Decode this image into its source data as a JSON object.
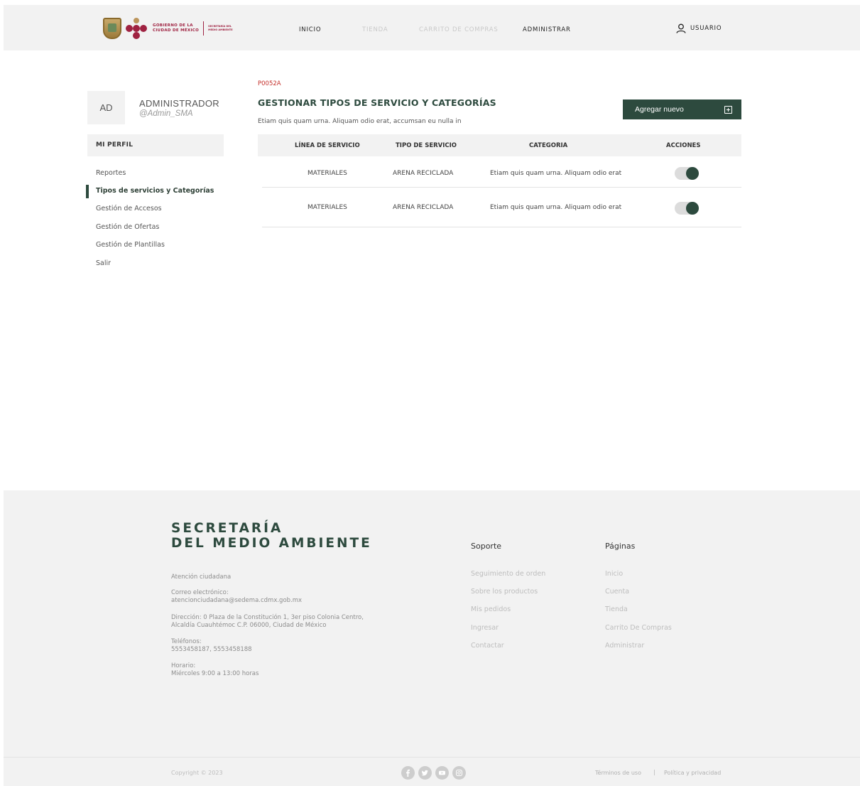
{
  "header": {
    "logo_gov_line1": "GOBIERNO DE LA",
    "logo_gov_line2": "CIUDAD DE MÉXICO",
    "logo_sec_line1": "SECRETARÍA DEL",
    "logo_sec_line2": "MEDIO AMBIENTE",
    "nav": [
      "INICIO",
      "TIENDA",
      "CARRITO DE COMPRAS",
      "ADMINISTRAR"
    ],
    "user_label": "USUARIO"
  },
  "sidebar": {
    "initials": "AD",
    "name": "ADMINISTRADOR",
    "handle": "@Admin_SMA",
    "section_title": "MI PERFIL",
    "items": [
      "Reportes",
      "Tipos de servicios y Categorías",
      "Gestión de Accesos",
      "Gestión de Ofertas",
      "Gestión de Plantillas",
      "Salir"
    ],
    "active_index": 1
  },
  "main": {
    "code": "P0052A",
    "title": "GESTIONAR TIPOS DE SERVICIO Y CATEGORÍAS",
    "subtitle": "Etiam quis quam urna. Aliquam odio erat, accumsan eu nulla in",
    "add_button_label": "Agregar nuevo",
    "table": {
      "columns": [
        "LÍNEA DE SERVICIO",
        "TIPO DE SERVICIO",
        "CATEGORIA",
        "ACCIONES"
      ],
      "rows": [
        {
          "linea": "MATERIALES",
          "tipo": "ARENA RECICLADA",
          "categoria": "Etiam quis quam urna. Aliquam odio erat",
          "active": true
        },
        {
          "linea": "MATERIALES",
          "tipo": "ARENA RECICLADA",
          "categoria": "Etiam quis quam urna. Aliquam odio erat",
          "active": true
        }
      ]
    }
  },
  "footer": {
    "title_line1": "SECRETARÍA",
    "title_line2": "DEL MEDIO AMBIENTE",
    "attention": "Atención ciudadana",
    "email_label": "Correo electrónico:",
    "email": "atencionciudadana@sedema.cdmx.gob.mx",
    "address_line1": "Dirección: 0 Plaza de la Constitución 1, 3er piso Colonia Centro,",
    "address_line2": "Alcaldía Cuauhtémoc C.P. 06000, Ciudad de México",
    "phones_label": "Teléfonos:",
    "phones": "5553458187, 5553458188",
    "hours_label": "Horario:",
    "hours": "Miércoles 9:00 a 13:00 horas",
    "support_title": "Soporte",
    "support_links": [
      "Seguimiento de orden",
      "Sobre los productos",
      "Mis pedidos",
      "Ingresar",
      "Contactar"
    ],
    "pages_title": "Páginas",
    "pages_links": [
      "Inicio",
      "Cuenta",
      "Tienda",
      "Carrito De Compras",
      "Administrar"
    ],
    "copyright": "Copyright © 2023",
    "social_icons": [
      "facebook-icon",
      "twitter-icon",
      "youtube-icon",
      "instagram-icon"
    ],
    "terms": "Términos de uso",
    "separator": "|",
    "privacy": "Política y privacidad"
  },
  "colors": {
    "brand_green": "#2d4a3e",
    "brand_red": "#9f2241",
    "code_red": "#c4302b"
  }
}
